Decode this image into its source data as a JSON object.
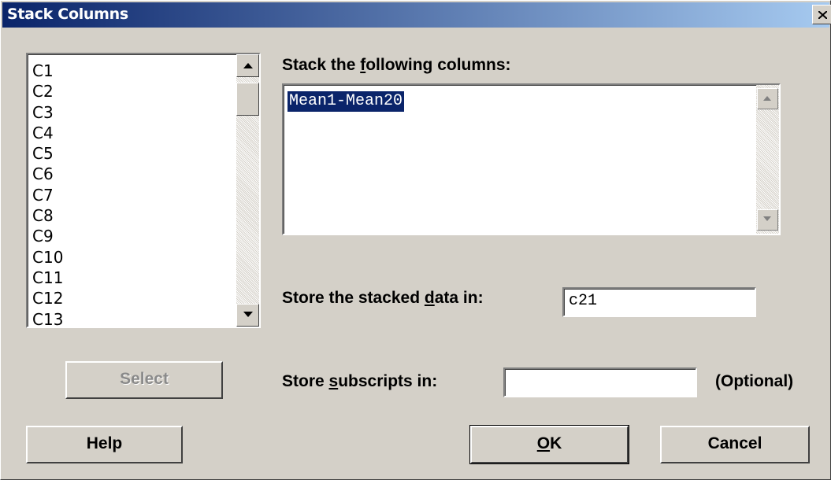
{
  "window": {
    "title": "Stack Columns"
  },
  "column_list": {
    "items": [
      "C1",
      "C2",
      "C3",
      "C4",
      "C5",
      "C6",
      "C7",
      "C8",
      "C9",
      "C10",
      "C11",
      "C12",
      "C13"
    ]
  },
  "stack": {
    "label_pre": "Stack the ",
    "label_u": "f",
    "label_post": "ollowing columns:",
    "value": "Mean1-Mean20"
  },
  "store_data": {
    "label_pre": "Store the stacked ",
    "label_u": "d",
    "label_post": "ata in:",
    "value": "c21"
  },
  "subscripts": {
    "label_pre": "Store ",
    "label_u": "s",
    "label_post": "ubscripts in:",
    "value": "",
    "optional": "(Optional)"
  },
  "buttons": {
    "select": "Select",
    "help": "Help",
    "ok_u": "O",
    "ok_post": "K",
    "cancel": "Cancel"
  }
}
